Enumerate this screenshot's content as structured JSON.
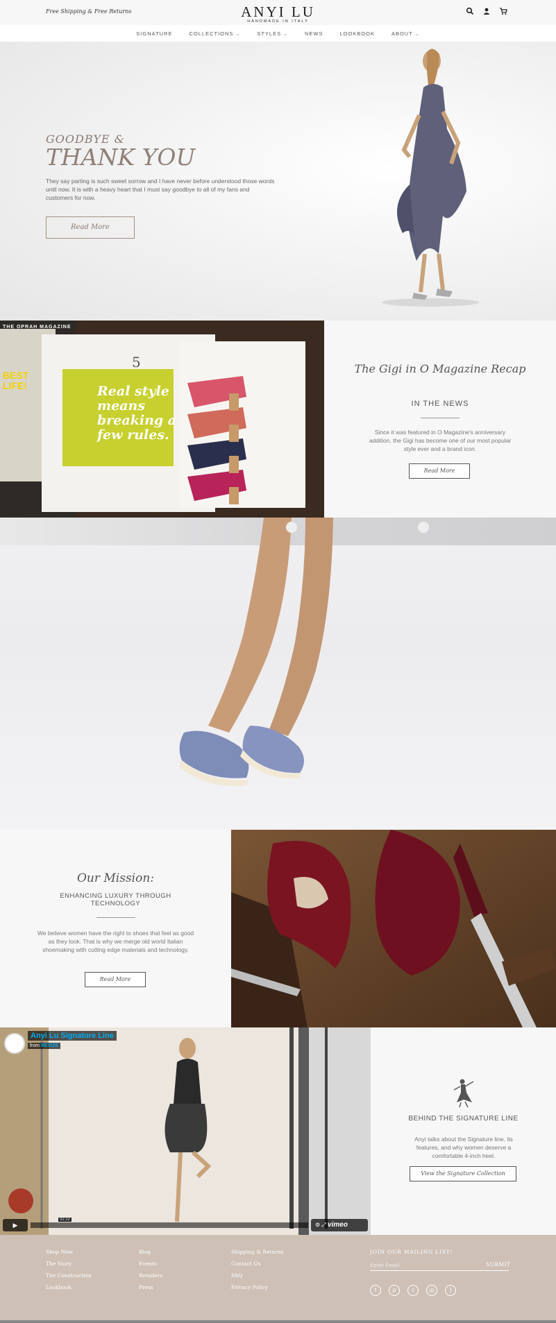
{
  "topbar": {
    "promo": "Free Shipping & Free Returns",
    "brand": "ANYI LU",
    "tagline": "HANDMADE IN ITALY",
    "icons": [
      "search-icon",
      "account-icon",
      "cart-icon"
    ]
  },
  "nav": {
    "items": [
      {
        "label": "SIGNATURE",
        "dropdown": false
      },
      {
        "label": "COLLECTIONS",
        "dropdown": true
      },
      {
        "label": "STYLES",
        "dropdown": true
      },
      {
        "label": "NEWS",
        "dropdown": false
      },
      {
        "label": "LOOKBOOK",
        "dropdown": false
      },
      {
        "label": "ABOUT",
        "dropdown": true
      }
    ],
    "chevron": "⌄"
  },
  "hero": {
    "kicker": "GOODBYE &",
    "headline": "THANK YOU",
    "body": "They say parting is such sweet sorrow and I have never before understood those words until now. It is with a heavy heart that I must say goodbye to all of my fans and customers for now.",
    "button": "Read More"
  },
  "magazine": {
    "title": "The Gigi in O Magazine Recap",
    "subtitle": "IN THE NEWS",
    "description": "Since it was featured in O Magazine's anniversary addition, the Gigi has become one of our most popular style ever and a brand icon.",
    "button": "Read More",
    "image_text": {
      "page_number": "5",
      "cover_brand": "THE OPRAH MAGAZINE",
      "cover_line": "BEST LIFE!",
      "spread_quote": "Real style means breaking a few rules."
    }
  },
  "mission": {
    "title": "Our Mission:",
    "subtitle": "ENHANCING LUXURY THROUGH TECHNOLOGY",
    "description": "We believe women have the right to shoes that feel as good as they look. That is why we merge old world Italian shoemaking with cutting edge materials and technology.",
    "button": "Read More"
  },
  "video": {
    "title": "Anyi Lu Signature Line",
    "from_prefix": "from",
    "from_name": "REVIZE",
    "time": "02:22",
    "player": "vimeo"
  },
  "signature": {
    "title": "BEHIND THE SIGNATURE LINE",
    "description": "Anyi talks about the Signature line, its features, and why women deserve a comfortable 4-inch heel.",
    "button": "View the Signature Collection"
  },
  "footer": {
    "col1": [
      "Shop Now",
      "The Story",
      "The Construction",
      "Lookbook"
    ],
    "col2": [
      "Blog",
      "Events",
      "Retailers",
      "Press"
    ],
    "col3": [
      "Shipping & Returns",
      "Contact Us",
      "FAQ",
      "Privacy Policy"
    ],
    "mailing_title": "JOIN OUR MAILING LIST!",
    "email_placeholder": "Enter Email",
    "submit": "SUBMIT",
    "social": [
      "facebook-icon",
      "pinterest-icon",
      "twitter-icon",
      "instagram-icon",
      "rss-icon"
    ]
  }
}
